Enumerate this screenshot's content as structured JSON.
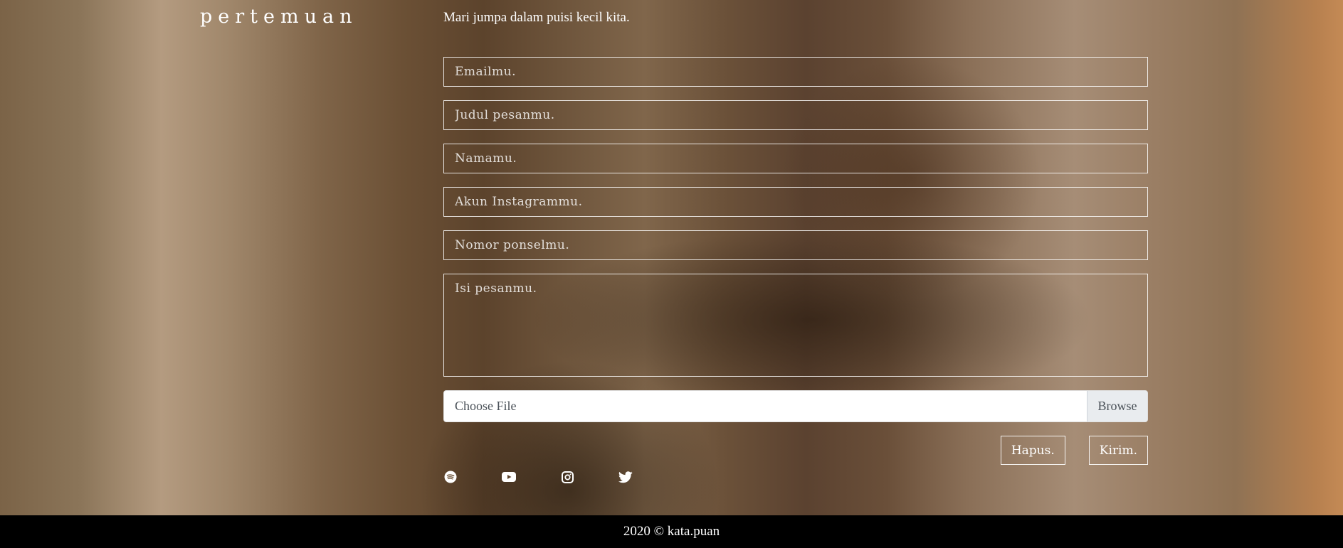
{
  "brand": {
    "name": "pertemuan"
  },
  "header": {
    "tagline": "Mari jumpa dalam puisi kecil kita."
  },
  "form": {
    "email_placeholder": "Emailmu.",
    "subject_placeholder": "Judul pesanmu.",
    "name_placeholder": "Namamu.",
    "instagram_placeholder": "Akun Instagrammu.",
    "phone_placeholder": "Nomor ponselmu.",
    "message_placeholder": "Isi pesanmu.",
    "file_label": "Choose File",
    "browse_label": "Browse",
    "reset_label": "Hapus.",
    "submit_label": "Kirim."
  },
  "socials": [
    "spotify-icon",
    "youtube-icon",
    "instagram-icon",
    "twitter-icon"
  ],
  "footer": {
    "text": "2020 © kata.puan"
  },
  "colors": {
    "footer_bg": "#000000",
    "text": "#ffffff",
    "file_bg": "#ffffff",
    "browse_bg": "#e9ecef"
  }
}
